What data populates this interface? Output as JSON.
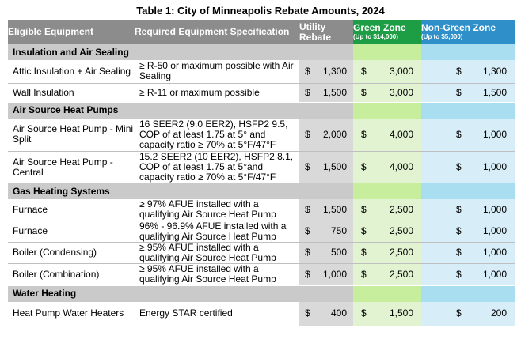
{
  "title": "Table 1: City of Minneapolis Rebate Amounts, 2024",
  "headers": {
    "equipment": "Eligible Equipment",
    "spec": "Required Equipment Specification",
    "utility": "Utility Rebate",
    "green": "Green Zone",
    "green_sub": "(Up to $14,000)",
    "nongreen": "Non-Green Zone",
    "nongreen_sub": "(Up to $5,000)"
  },
  "currency": "$",
  "colors": {
    "header_gray": "#8c8c8c",
    "green_zone": "#1e9e44",
    "nongreen_zone": "#2e8fc9"
  },
  "sections": [
    {
      "name": "Insulation and Air Sealing",
      "rows": [
        {
          "equipment": "Attic Insulation + Air Sealing",
          "spec": "≥ R-50 or maximum possible with Air Sealing",
          "utility": "1,300",
          "green": "3,000",
          "nongreen": "1,300"
        },
        {
          "equipment": "Wall Insulation",
          "spec": "≥ R-11 or maximum possible",
          "utility": "1,500",
          "green": "3,000",
          "nongreen": "1,500"
        }
      ]
    },
    {
      "name": "Air Source Heat Pumps",
      "rows": [
        {
          "equipment": "Air Source Heat Pump - Mini Split",
          "spec": "16 SEER2 (9.0 EER2), HSFP2 9.5, COP of at least 1.75 at 5° and capacity ratio ≥ 70% at 5°F/47°F",
          "utility": "2,000",
          "green": "4,000",
          "nongreen": "1,000"
        },
        {
          "equipment": "Air Source Heat Pump - Central",
          "spec": "15.2 SEER2 (10 EER2), HSFP2 8.1, COP of at least 1.75 at 5°and capacity ratio ≥ 70% at 5°F/47°F",
          "utility": "1,500",
          "green": "4,000",
          "nongreen": "1,000"
        }
      ]
    },
    {
      "name": "Gas Heating Systems",
      "rows": [
        {
          "equipment": "Furnace",
          "spec": "≥ 97% AFUE installed with a qualifying Air Source Heat Pump",
          "utility": "1,500",
          "green": "2,500",
          "nongreen": "1,000"
        },
        {
          "equipment": "Furnace",
          "spec": "96% - 96.9% AFUE installed with a qualifying Air Source Heat Pump",
          "utility": "750",
          "green": "2,500",
          "nongreen": "1,000"
        },
        {
          "equipment": "Boiler (Condensing)",
          "spec": "≥ 95% AFUE installed with a qualifying Air Source Heat Pump",
          "utility": "500",
          "green": "2,500",
          "nongreen": "1,000"
        },
        {
          "equipment": "Boiler (Combination)",
          "spec": "≥ 95% AFUE installed with a qualifying Air Source Heat Pump",
          "utility": "1,000",
          "green": "2,500",
          "nongreen": "1,000"
        }
      ]
    },
    {
      "name": "Water Heating",
      "rows": [
        {
          "equipment": "Heat Pump Water Heaters",
          "spec": "Energy STAR certified",
          "utility": "400",
          "green": "1,500",
          "nongreen": "200"
        }
      ]
    }
  ]
}
